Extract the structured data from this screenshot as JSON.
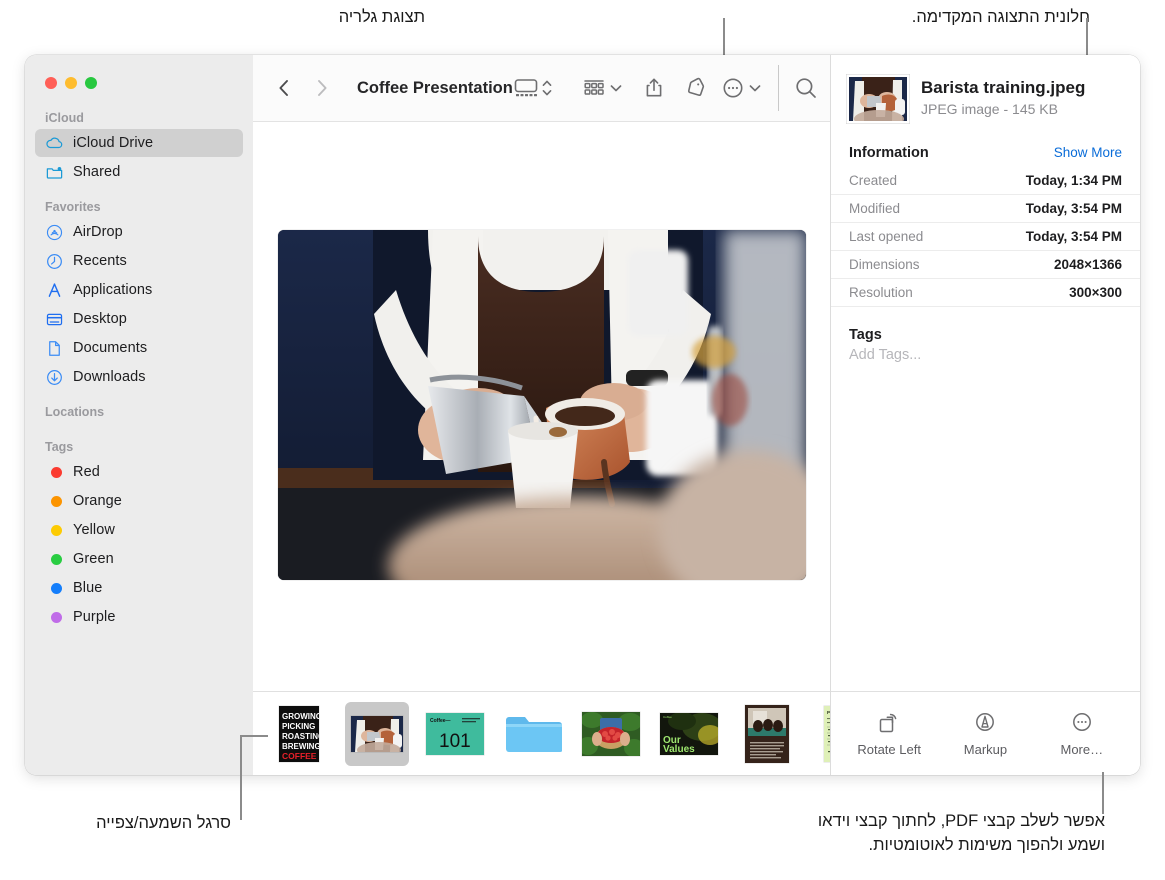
{
  "annotations": {
    "gallery_view": "תצוגת גלריה",
    "preview_pane": "חלונית התצוגה המקדימה.",
    "playback_bar": "סרגל השמעה/צפייה",
    "actions_note": "אפשר לשלב קבצי PDF, לחתוך קבצי וידאו\nושמע ולהפוך משימות לאוטומטיות."
  },
  "window": {
    "traffic_lights": [
      "close-button",
      "minimize-button",
      "maximize-button"
    ]
  },
  "sidebar": {
    "groups": [
      {
        "title": "iCloud",
        "items": [
          {
            "label": "iCloud Drive",
            "icon": "icloud-icon",
            "active": true
          },
          {
            "label": "Shared",
            "icon": "shared-folder-icon",
            "active": false
          }
        ]
      },
      {
        "title": "Favorites",
        "items": [
          {
            "label": "AirDrop",
            "icon": "airdrop-icon",
            "active": false
          },
          {
            "label": "Recents",
            "icon": "clock-icon",
            "active": false
          },
          {
            "label": "Applications",
            "icon": "applications-icon",
            "active": false
          },
          {
            "label": "Desktop",
            "icon": "desktop-icon",
            "active": false
          },
          {
            "label": "Documents",
            "icon": "document-icon",
            "active": false
          },
          {
            "label": "Downloads",
            "icon": "download-icon",
            "active": false
          }
        ]
      },
      {
        "title": "Locations",
        "items": []
      },
      {
        "title": "Tags",
        "items": [
          {
            "label": "Red",
            "color": "#fb3b30"
          },
          {
            "label": "Orange",
            "color": "#fc9400"
          },
          {
            "label": "Yellow",
            "color": "#fdcb02"
          },
          {
            "label": "Green",
            "color": "#29cd42"
          },
          {
            "label": "Blue",
            "color": "#147efb"
          },
          {
            "label": "Purple",
            "color": "#c06ce8"
          }
        ]
      }
    ]
  },
  "toolbar": {
    "back": "back-button",
    "forward": "forward-button",
    "title": "Coffee Presentation",
    "buttons": [
      {
        "name": "gallery-view-button",
        "icon": "gallery-view-icon"
      },
      {
        "name": "view-stepper",
        "icon": "chevron-up-down-icon"
      },
      {
        "name": "group-by-button",
        "icon": "group-grid-icon"
      },
      {
        "name": "group-by-chevron",
        "icon": "chevron-down-icon"
      },
      {
        "name": "share-button",
        "icon": "share-icon"
      },
      {
        "name": "tag-button",
        "icon": "tag-icon"
      },
      {
        "name": "more-actions-button",
        "icon": "ellipsis-circle-icon"
      },
      {
        "name": "more-actions-chevron",
        "icon": "chevron-down-icon"
      },
      {
        "name": "search-button",
        "icon": "search-icon"
      }
    ]
  },
  "preview": {
    "alt": "Barista pouring milk and espresso into a cup"
  },
  "filmstrip": {
    "items": [
      {
        "name": "thumbnail-growing-picking-roasting",
        "kind": "poster",
        "selected": false,
        "lines": [
          "GROWING",
          "PICKING",
          "ROASTING",
          "BREWING"
        ],
        "accent_line": "COFFEE"
      },
      {
        "name": "thumbnail-barista-training",
        "kind": "photo-barista",
        "selected": true
      },
      {
        "name": "thumbnail-coffee-101",
        "kind": "slide-101",
        "selected": false,
        "heading": "Coffee—",
        "big": "101"
      },
      {
        "name": "thumbnail-folder",
        "kind": "folder",
        "selected": false
      },
      {
        "name": "thumbnail-berries",
        "kind": "photo-berries",
        "selected": false
      },
      {
        "name": "thumbnail-our-values",
        "kind": "slide-values",
        "selected": false,
        "big": "Our\nValues"
      },
      {
        "name": "thumbnail-meeting-doc",
        "kind": "doc-meeting",
        "selected": false
      },
      {
        "name": "thumbnail-produce-invoice",
        "kind": "doc-invoice",
        "selected": false,
        "heading": "Produce"
      }
    ]
  },
  "inspector": {
    "file_name": "Barista training.jpeg",
    "file_meta": "JPEG image - 145 KB",
    "information_title": "Information",
    "show_more": "Show More",
    "rows": [
      {
        "key": "Created",
        "value": "Today, 1:34 PM"
      },
      {
        "key": "Modified",
        "value": "Today, 3:54 PM"
      },
      {
        "key": "Last opened",
        "value": "Today, 3:54 PM"
      },
      {
        "key": "Dimensions",
        "value": "2048×1366"
      },
      {
        "key": "Resolution",
        "value": "300×300"
      }
    ],
    "tags_title": "Tags",
    "tags_placeholder": "Add Tags...",
    "actions": [
      {
        "label": "Rotate Left",
        "icon": "rotate-left-icon"
      },
      {
        "label": "Markup",
        "icon": "markup-icon"
      },
      {
        "label": "More…",
        "icon": "ellipsis-circle-icon"
      }
    ]
  },
  "colors": {
    "accent_link": "#0a6cd8",
    "sidebar_bg": "#ececec",
    "selection": "#d0d0d0"
  }
}
